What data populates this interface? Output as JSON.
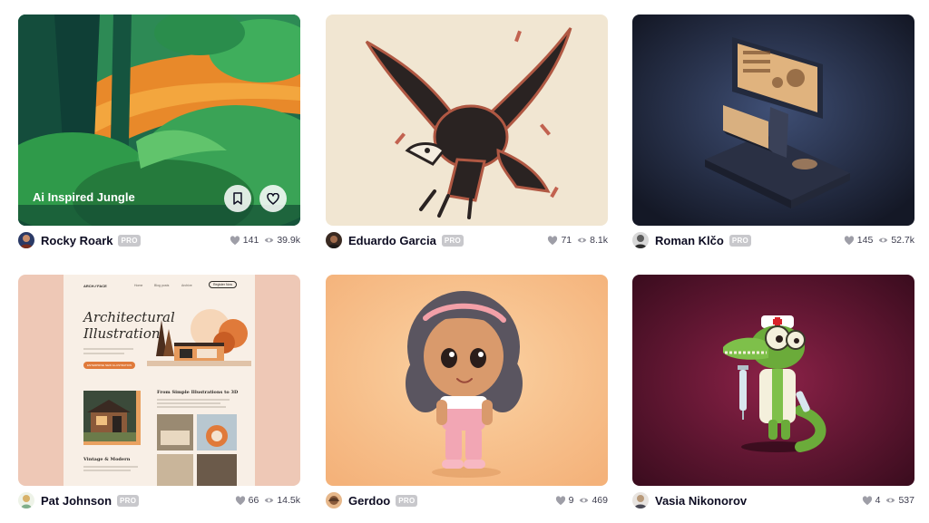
{
  "icons": {
    "like": "heart-icon",
    "views": "eye-icon",
    "save": "bookmark-icon"
  },
  "shots": [
    {
      "title": "Ai Inspired Jungle",
      "author": "Rocky Roark",
      "badge": "PRO",
      "likes": "141",
      "views": "39.9k"
    },
    {
      "author": "Eduardo Garcia",
      "badge": "PRO",
      "likes": "71",
      "views": "8.1k"
    },
    {
      "author": "Roman Klčo",
      "badge": "PRO",
      "likes": "145",
      "views": "52.7k"
    },
    {
      "author": "Pat Johnson",
      "badge": "PRO",
      "likes": "66",
      "views": "14.5k",
      "mock": {
        "brand": "ARCH ⁄⁄ FACE",
        "nav": [
          "Home",
          "Blog posts",
          "Archive"
        ],
        "cta": "Register Now",
        "headline_1": "Architectural",
        "headline_2": "Illustration",
        "pill": "ENTERPRISE NEW ILLUSTRATION",
        "section_1": "From Simple Illustrations to 3D",
        "section_2": "Vintage & Modern"
      }
    },
    {
      "author": "Gerdoo",
      "badge": "PRO",
      "likes": "9",
      "views": "469"
    },
    {
      "author": "Vasia Nikonorov",
      "likes": "4",
      "views": "537"
    }
  ]
}
